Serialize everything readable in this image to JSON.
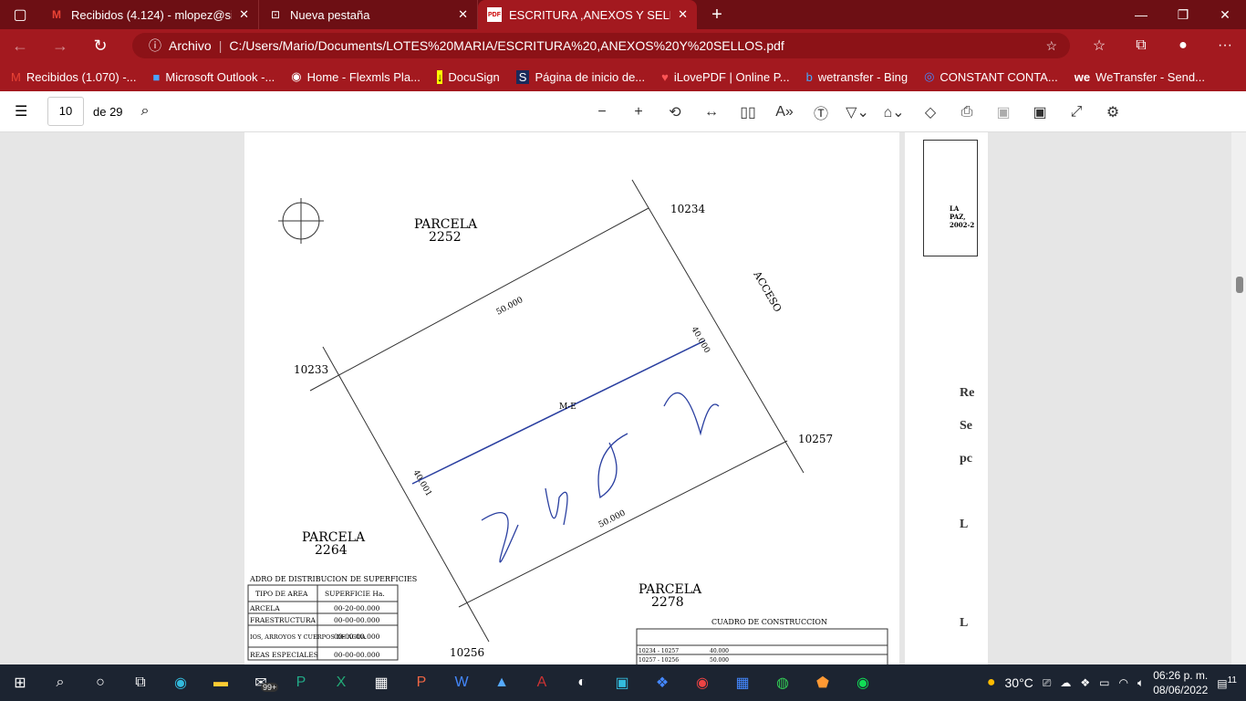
{
  "tabs": [
    {
      "label": "Recibidos (4.124) - mlopez@sirlo",
      "icon": "gmail-icon"
    },
    {
      "label": "Nueva pestaña",
      "icon": "new-tab-icon"
    },
    {
      "label": "ESCRITURA ,ANEXOS Y SELLOS.p",
      "icon": "pdf-icon"
    }
  ],
  "address": {
    "security_label": "Archivo",
    "url": "C:/Users/Mario/Documents/LOTES%20MARIA/ESCRITURA%20,ANEXOS%20Y%20SELLOS.pdf"
  },
  "bookmarks": [
    "Recibidos (1.070) -...",
    "Microsoft Outlook -...",
    "Home - Flexmls Pla...",
    "DocuSign",
    "Página de inicio de...",
    "iLovePDF | Online P...",
    "wetransfer - Bing",
    "CONSTANT CONTA...",
    "WeTransfer - Send..."
  ],
  "pdf": {
    "page": "10",
    "of_pages": "de 29"
  },
  "drawing": {
    "parcel_label": "PARCELA",
    "parcels": [
      "2252",
      "2264",
      "2278"
    ],
    "points": [
      "10234",
      "10233",
      "10257",
      "10256"
    ],
    "distances": [
      "50.000",
      "40.000",
      "50.000",
      "40.001"
    ],
    "access": "ACCESO",
    "center": "M-E",
    "dist_table_title": "ADRO DE DISTRIBUCION DE SUPERFICIES",
    "dist_table_headers": [
      "TIPO DE AREA",
      "SUPERFICIE Ha."
    ],
    "dist_table_rows": [
      [
        "ARCELA",
        "00-20-00.000"
      ],
      [
        "FRAESTRUCTURA",
        "00-00-00.000"
      ],
      [
        "IOS, ARROYOS Y CUERPOS DE AGUA",
        "00-00-00.000"
      ],
      [
        "REAS ESPECIALES",
        "00-00-00.000"
      ]
    ],
    "cons_table_title": "CUADRO DE CONSTRUCCION",
    "cons_table_rows": [
      [
        "10234 - 10257",
        "40.000"
      ],
      [
        "10257 - 10256",
        "50.000"
      ]
    ]
  },
  "page2": {
    "lines": [
      "Re",
      "Se",
      "pc",
      "L",
      "L"
    ],
    "stamp_city": "LA PAZ,",
    "stamp_years": "2002-2"
  },
  "taskbar": {
    "badge": "99+",
    "weather": "30°C",
    "time": "06:26 p. m.",
    "date": "08/06/2022",
    "notifications": "11"
  }
}
